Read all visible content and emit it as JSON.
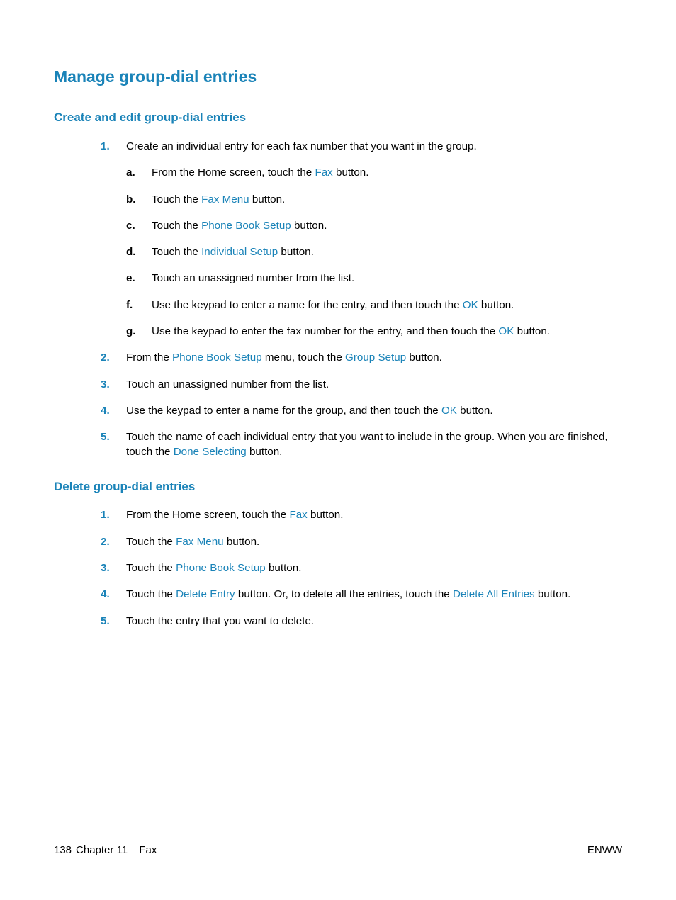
{
  "page_title": "Manage group-dial entries",
  "section1": {
    "heading": "Create and edit group-dial entries",
    "steps": [
      {
        "n": "1.",
        "text": "Create an individual entry for each fax number that you want in the group."
      },
      {
        "n": "2.",
        "pre": "From the ",
        "link1": "Phone Book Setup",
        "mid": " menu, touch the ",
        "link2": "Group Setup",
        "post": " button."
      },
      {
        "n": "3.",
        "text": "Touch an unassigned number from the list."
      },
      {
        "n": "4.",
        "pre": "Use the keypad to enter a name for the group, and then touch the ",
        "link1": "OK",
        "post": " button."
      },
      {
        "n": "5.",
        "pre": "Touch the name of each individual entry that you want to include in the group. When you are finished, touch the ",
        "link1": "Done Selecting",
        "post": " button."
      }
    ],
    "substeps": [
      {
        "l": "a.",
        "pre": "From the Home screen, touch the ",
        "link1": "Fax",
        "post": " button."
      },
      {
        "l": "b.",
        "pre": "Touch the ",
        "link1": "Fax Menu",
        "post": " button."
      },
      {
        "l": "c.",
        "pre": "Touch the ",
        "link1": "Phone Book Setup",
        "post": " button."
      },
      {
        "l": "d.",
        "pre": "Touch the ",
        "link1": "Individual Setup",
        "post": " button."
      },
      {
        "l": "e.",
        "text": "Touch an unassigned number from the list."
      },
      {
        "l": "f.",
        "pre": "Use the keypad to enter a name for the entry, and then touch the ",
        "link1": "OK",
        "post": " button."
      },
      {
        "l": "g.",
        "pre": "Use the keypad to enter the fax number for the entry, and then touch the ",
        "link1": "OK",
        "post": " button."
      }
    ]
  },
  "section2": {
    "heading": "Delete group-dial entries",
    "steps": [
      {
        "n": "1.",
        "pre": "From the Home screen, touch the ",
        "link1": "Fax",
        "post": " button."
      },
      {
        "n": "2.",
        "pre": "Touch the ",
        "link1": "Fax Menu",
        "post": " button."
      },
      {
        "n": "3.",
        "pre": "Touch the ",
        "link1": "Phone Book Setup",
        "post": " button."
      },
      {
        "n": "4.",
        "pre": "Touch the ",
        "link1": "Delete Entry",
        "mid": " button. Or, to delete all the entries, touch the ",
        "link2": "Delete All Entries",
        "post": " button."
      },
      {
        "n": "5.",
        "text": "Touch the entry that you want to delete."
      }
    ]
  },
  "footer": {
    "page": "138",
    "chapter": "Chapter 11",
    "chapter_title": "Fax",
    "right": "ENWW"
  }
}
